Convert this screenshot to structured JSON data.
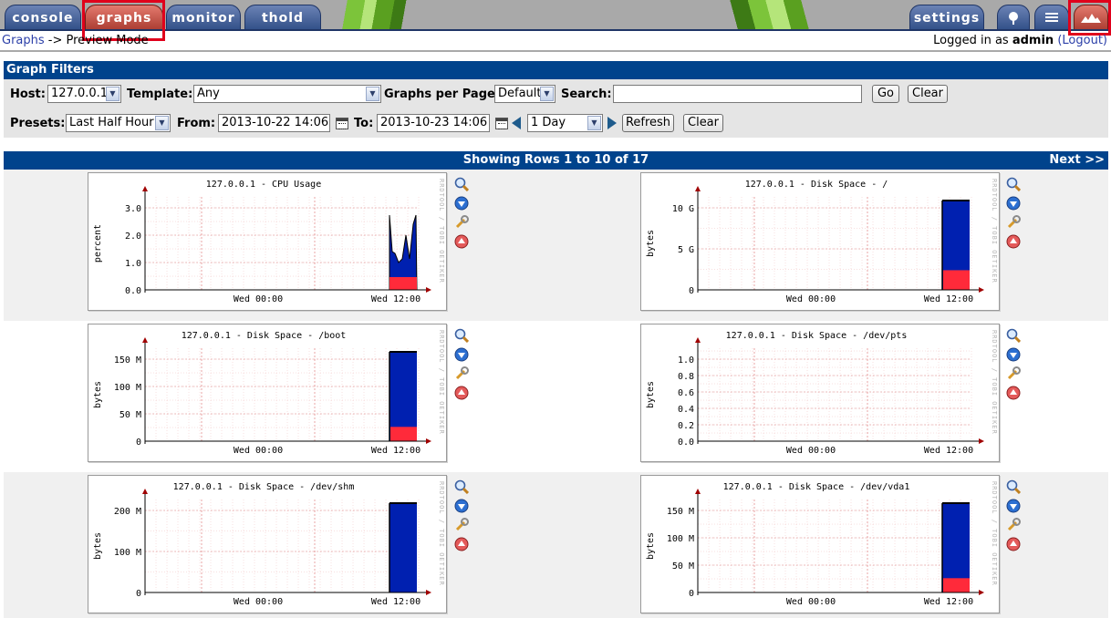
{
  "tabs": [
    {
      "id": "console",
      "label": "console"
    },
    {
      "id": "graphs",
      "label": "graphs",
      "active": true
    },
    {
      "id": "monitor",
      "label": "monitor"
    },
    {
      "id": "thold",
      "label": "thold"
    }
  ],
  "right_tabs": {
    "settings_label": "settings",
    "tree_icon": "tree-icon",
    "list_icon": "list-icon",
    "preview_icon": "preview-mountain-icon"
  },
  "breadcrumb": {
    "link": "Graphs",
    "separator": " -> ",
    "current": "Preview Mode"
  },
  "login": {
    "prefix": "Logged in as ",
    "user": "admin",
    "open": " (",
    "logout": "Logout",
    "close": ")"
  },
  "filters": {
    "title": "Graph Filters",
    "host_label": "Host:",
    "host_value": "127.0.0.1",
    "template_label": "Template:",
    "template_value": "Any",
    "per_page_label": "Graphs per Page:",
    "per_page_value": "Default",
    "search_label": "Search:",
    "search_value": "",
    "go_label": "Go",
    "clear_label": "Clear",
    "presets_label": "Presets:",
    "presets_value": "Last Half Hour",
    "from_label": "From:",
    "from_value": "2013-10-22 14:06",
    "to_label": "To:",
    "to_value": "2013-10-23 14:06",
    "timespan_value": "1 Day",
    "refresh_label": "Refresh",
    "clear2_label": "Clear"
  },
  "results": {
    "rows_text": "Showing Rows 1 to 10 of 17",
    "next_label": "Next >>"
  },
  "colors": {
    "header_blue": "#00438c",
    "tab_blue": "#2f4d86",
    "tab_active": "#a83a2f",
    "selection_red": "#e0001b",
    "area_blue": "#0020b0",
    "area_red": "#ff2a3a"
  },
  "graph_watermark": "RRDTOOL / TOBI OETIKER",
  "graph_icons": [
    "zoom-icon",
    "download-icon",
    "wrench-icon",
    "arrow-up-icon"
  ],
  "graphs": [
    {
      "title": "127.0.0.1 - CPU Usage",
      "ylabel": "percent",
      "ticks": [
        "3.0",
        "2.0",
        "1.0",
        "0.0"
      ],
      "xticks": [
        "Wed 00:00",
        "Wed 12:00"
      ],
      "kind": "cpu"
    },
    {
      "title": "127.0.0.1 - Disk Space - /",
      "ylabel": "bytes",
      "ticks": [
        "10 G",
        "5 G",
        "0"
      ],
      "xticks": [
        "Wed 00:00",
        "Wed 12:00"
      ],
      "kind": "disk",
      "fill": 1.0,
      "red": 0.22
    },
    {
      "title": "127.0.0.1 - Disk Space - /boot",
      "ylabel": "bytes",
      "ticks": [
        "150 M",
        "100 M",
        "50 M",
        "0"
      ],
      "xticks": [
        "Wed 00:00",
        "Wed 12:00"
      ],
      "kind": "disk",
      "fill": 1.0,
      "red": 0.16
    },
    {
      "title": "127.0.0.1 - Disk Space - /dev/pts",
      "ylabel": "bytes",
      "ticks": [
        "1.0",
        "0.8",
        "0.6",
        "0.4",
        "0.2",
        "0.0"
      ],
      "xticks": [
        "Wed 00:00",
        "Wed 12:00"
      ],
      "kind": "empty"
    },
    {
      "title": "127.0.0.1 - Disk Space - /dev/shm",
      "ylabel": "bytes",
      "ticks": [
        "200 M",
        "100 M",
        "0"
      ],
      "xticks": [
        "Wed 00:00",
        "Wed 12:00"
      ],
      "kind": "disk",
      "fill": 1.0,
      "red": 0.0
    },
    {
      "title": "127.0.0.1 - Disk Space - /dev/vda1",
      "ylabel": "bytes",
      "ticks": [
        "150 M",
        "100 M",
        "50 M",
        "0"
      ],
      "xticks": [
        "Wed 00:00",
        "Wed 12:00"
      ],
      "kind": "disk",
      "fill": 1.0,
      "red": 0.16
    }
  ]
}
